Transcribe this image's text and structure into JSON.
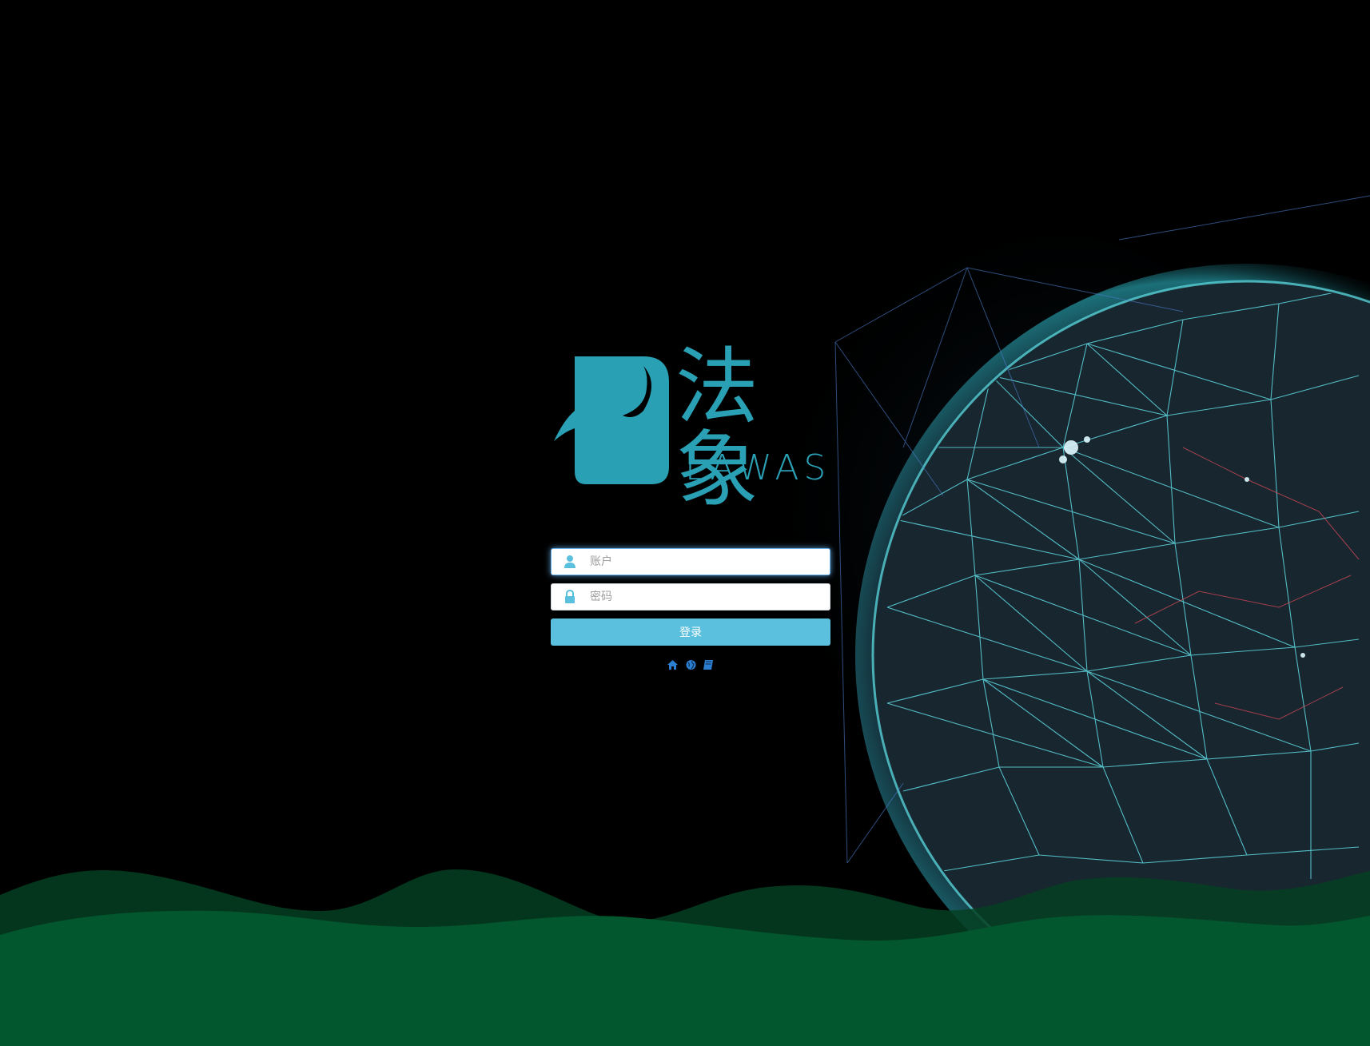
{
  "brand": {
    "name_cn": "法象",
    "name_en": "LAWAS",
    "color": "#2aa0b4"
  },
  "login": {
    "account_placeholder": "账户",
    "password_placeholder": "密码",
    "submit_label": "登录",
    "button_color": "#5bc0de"
  },
  "footer_links": [
    {
      "icon": "home-icon"
    },
    {
      "icon": "globe-icon"
    },
    {
      "icon": "book-icon"
    }
  ],
  "background": {
    "base_color": "#000000",
    "wave_color": "#03572e",
    "wave_back_color": "#063a1f",
    "network_color": "#59d8e0"
  }
}
